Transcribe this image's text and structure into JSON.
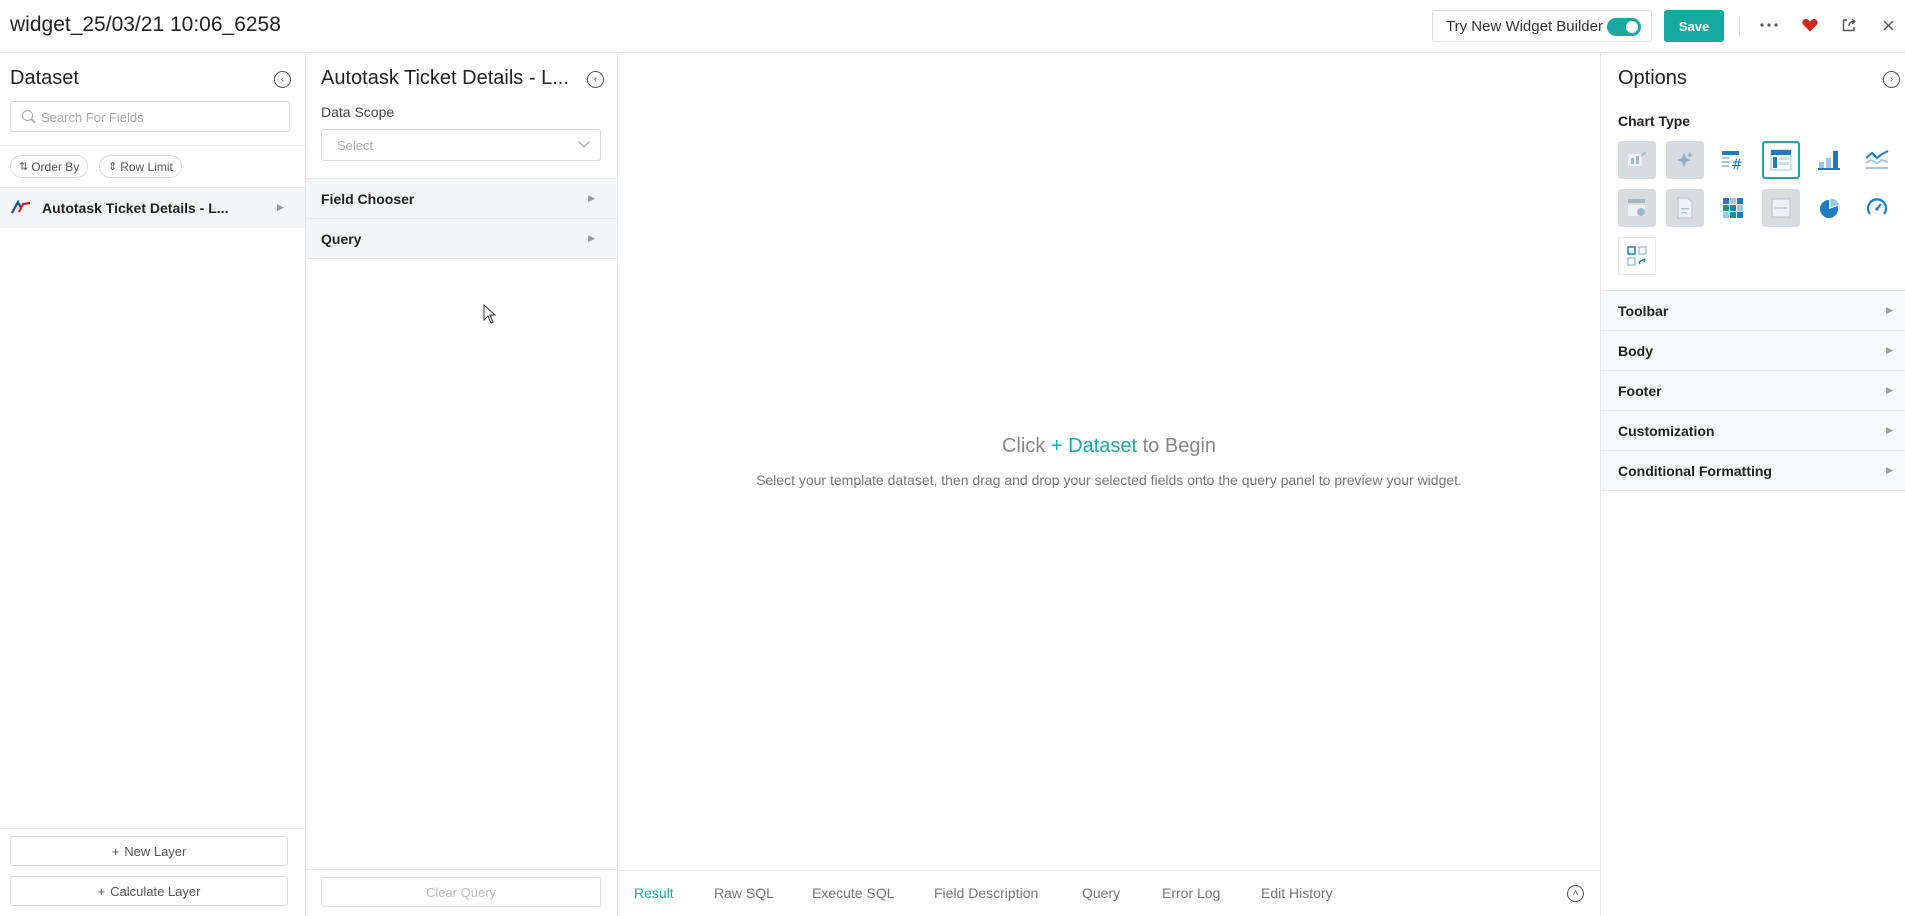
{
  "header": {
    "title": "widget_25/03/21 10:06_6258",
    "try_new_label": "Try New Widget Builder",
    "save_label": "Save"
  },
  "dataset_panel": {
    "title": "Dataset",
    "search_placeholder": "Search For Fields",
    "order_by_label": "Order By",
    "row_limit_label": "Row Limit",
    "dataset_name": "Autotask Ticket Details - L...",
    "new_layer_label": "New Layer",
    "calculate_layer_label": "Calculate Layer"
  },
  "query_panel": {
    "title": "Autotask Ticket Details - L...",
    "data_scope_label": "Data Scope",
    "data_scope_placeholder": "Select",
    "sections": [
      "Field Chooser",
      "Query"
    ],
    "clear_query_label": "Clear Query"
  },
  "center": {
    "empty_prefix": "Click",
    "empty_link": "+ Dataset",
    "empty_suffix": "to Begin",
    "empty_description": "Select your template dataset, then drag and drop your selected fields onto the query panel to preview your widget.",
    "tabs": [
      "Result",
      "Raw SQL",
      "Execute SQL",
      "Field Description",
      "Query",
      "Error Log",
      "Edit History"
    ],
    "active_tab": "Result"
  },
  "options_panel": {
    "title": "Options",
    "chart_type_label": "Chart Type",
    "chart_types": [
      {
        "icon": "kpi-card-icon",
        "state": "disabled"
      },
      {
        "icon": "ai-sparkle-icon",
        "state": "disabled"
      },
      {
        "icon": "number-table-icon",
        "state": "enabled"
      },
      {
        "icon": "table-icon",
        "state": "selected"
      },
      {
        "icon": "bar-chart-icon",
        "state": "enabled"
      },
      {
        "icon": "line-chart-icon",
        "state": "enabled"
      },
      {
        "icon": "custom-table-icon",
        "state": "disabled"
      },
      {
        "icon": "document-icon",
        "state": "disabled"
      },
      {
        "icon": "heatmap-grid-icon",
        "state": "enabled"
      },
      {
        "icon": "html-icon",
        "state": "disabled"
      },
      {
        "icon": "pie-chart-icon",
        "state": "enabled"
      },
      {
        "icon": "gauge-icon",
        "state": "enabled"
      },
      {
        "icon": "pivot-icon",
        "state": "enabled"
      }
    ],
    "sections": [
      "Toolbar",
      "Body",
      "Footer",
      "Customization",
      "Conditional Formatting"
    ]
  },
  "colors": {
    "accent": "#1aa8a0",
    "save_button": "#14a99e",
    "favorite": "#d0241c",
    "chart_blue": "#1f7bbf"
  }
}
